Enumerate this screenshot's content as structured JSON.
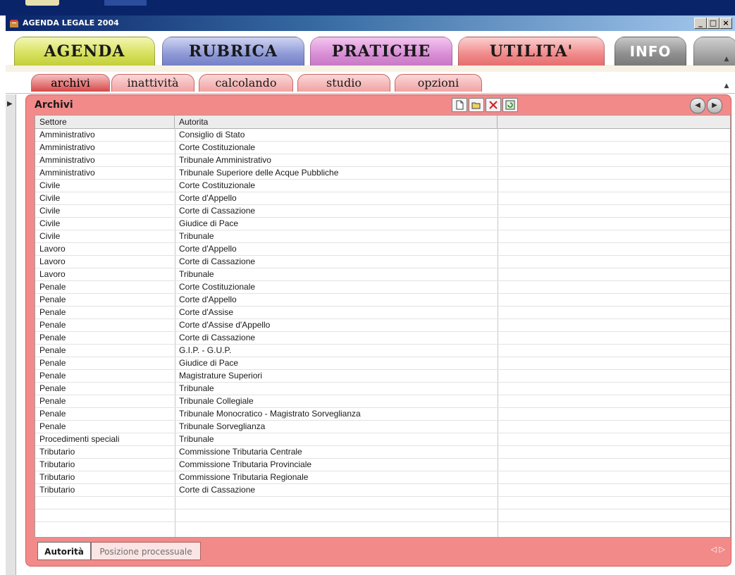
{
  "window": {
    "title": "AGENDA LEGALE 2004",
    "controls": {
      "minimize": "_",
      "maximize": "□",
      "close": "×"
    }
  },
  "main_tabs": [
    {
      "label": "AGENDA"
    },
    {
      "label": "RUBRICA"
    },
    {
      "label": "PRATICHE"
    },
    {
      "label": "UTILITA'"
    },
    {
      "label": "INFO"
    }
  ],
  "sub_tabs": [
    {
      "label": "archivi",
      "active": true
    },
    {
      "label": "inattività"
    },
    {
      "label": "calcolando"
    },
    {
      "label": "studio"
    },
    {
      "label": "opzioni"
    }
  ],
  "panel": {
    "title": "Archivi",
    "toolbar_icons": [
      "new-icon",
      "open-icon",
      "delete-icon",
      "refresh-icon"
    ],
    "nav_icons": [
      "previous-icon",
      "next-icon"
    ]
  },
  "grid": {
    "columns": [
      "Settore",
      "Autorita",
      ""
    ],
    "rows": [
      [
        "Amministrativo",
        "Consiglio di Stato"
      ],
      [
        "Amministrativo",
        "Corte Costituzionale"
      ],
      [
        "Amministrativo",
        "Tribunale Amministrativo"
      ],
      [
        "Amministrativo",
        "Tribunale Superiore delle Acque Pubbliche"
      ],
      [
        "Civile",
        "Corte Costituzionale"
      ],
      [
        "Civile",
        "Corte d'Appello"
      ],
      [
        "Civile",
        "Corte di Cassazione"
      ],
      [
        "Civile",
        "Giudice di Pace"
      ],
      [
        "Civile",
        "Tribunale"
      ],
      [
        "Lavoro",
        "Corte d'Appello"
      ],
      [
        "Lavoro",
        "Corte di Cassazione"
      ],
      [
        "Lavoro",
        "Tribunale"
      ],
      [
        "Penale",
        "Corte Costituzionale"
      ],
      [
        "Penale",
        "Corte d'Appello"
      ],
      [
        "Penale",
        "Corte d'Assise"
      ],
      [
        "Penale",
        "Corte d'Assise d'Appello"
      ],
      [
        "Penale",
        "Corte di Cassazione"
      ],
      [
        "Penale",
        "G.I.P. - G.U.P."
      ],
      [
        "Penale",
        "Giudice di Pace"
      ],
      [
        "Penale",
        "Magistrature Superiori"
      ],
      [
        "Penale",
        "Tribunale"
      ],
      [
        "Penale",
        "Tribunale Collegiale"
      ],
      [
        "Penale",
        "Tribunale Monocratico - Magistrato Sorveglianza"
      ],
      [
        "Penale",
        "Tribunale Sorveglianza"
      ],
      [
        "Procedimenti speciali",
        "Tribunale"
      ],
      [
        "Tributario",
        "Commissione Tributaria Centrale"
      ],
      [
        "Tributario",
        "Commissione Tributaria Provinciale"
      ],
      [
        "Tributario",
        "Commissione Tributaria Regionale"
      ],
      [
        "Tributario",
        "Corte di Cassazione"
      ],
      [
        "",
        ""
      ],
      [
        "",
        ""
      ]
    ]
  },
  "bottom_tabs": [
    {
      "label": "Autorità",
      "active": true
    },
    {
      "label": "Posizione processuale"
    }
  ]
}
